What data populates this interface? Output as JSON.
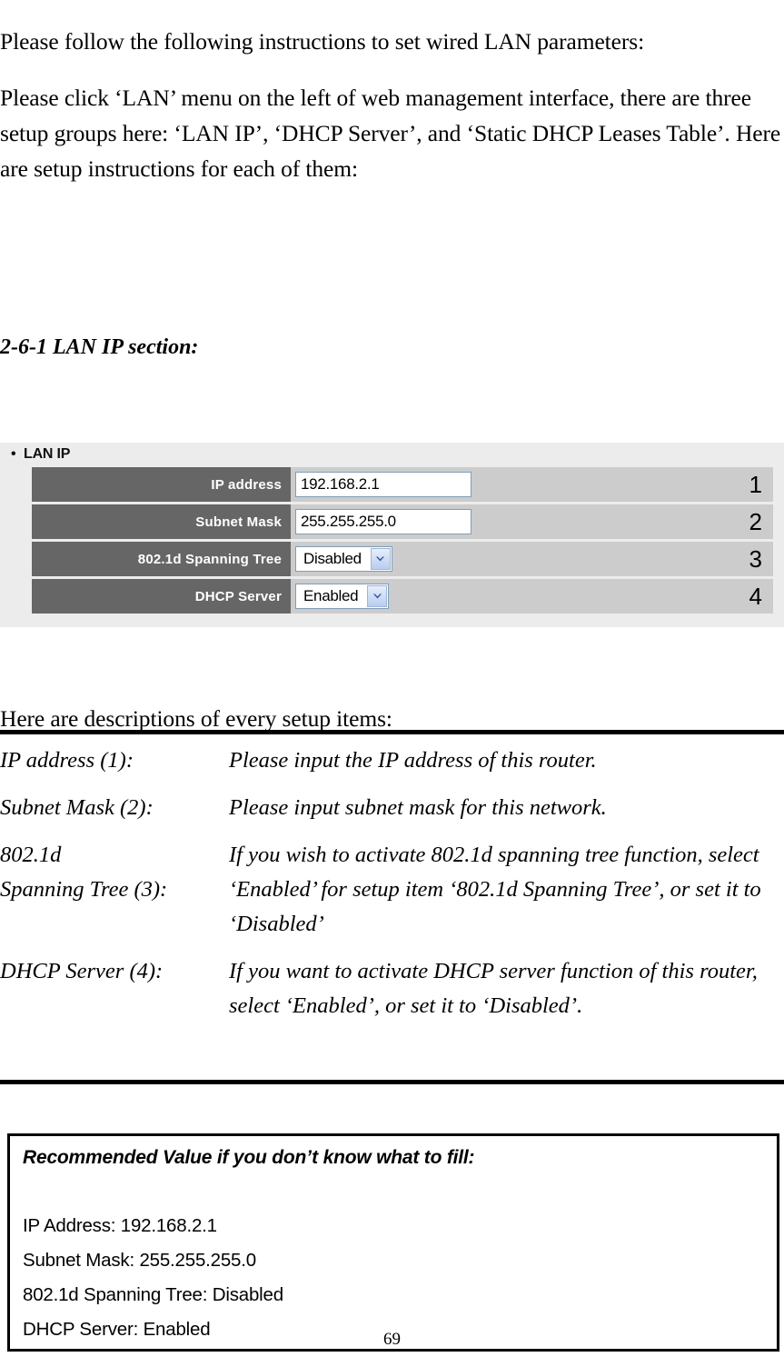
{
  "document": {
    "intro_paragraph_1": "Please follow the following instructions to set wired LAN parameters:",
    "intro_paragraph_2": "Please click ‘LAN’ menu on the left of web management interface, there are three setup groups here: ‘LAN IP’, ‘DHCP Server’, and ‘Static DHCP Leases Table’. Here are setup instructions for each of them:",
    "section_heading": "2-6-1 LAN IP section:",
    "descriptions_intro": "Here are descriptions of every setup items:",
    "page_number": "69"
  },
  "ui_panel": {
    "group_title": "LAN IP",
    "bullet_glyph": "•",
    "colors": {
      "panel_background": "#ececec",
      "label_cell": "#666666",
      "value_cell": "#cccccc",
      "input_border": "#7f9db9",
      "input_background": "#ffffff",
      "dropdown_arrow": "#2b5797"
    },
    "rows": [
      {
        "label": "IP address",
        "control": "textbox",
        "value": "192.168.2.1",
        "number": "1"
      },
      {
        "label": "Subnet Mask",
        "control": "textbox",
        "value": "255.255.255.0",
        "number": "2"
      },
      {
        "label": "802.1d Spanning Tree",
        "control": "dropdown",
        "value": "Disabled",
        "number": "3"
      },
      {
        "label": "DHCP Server",
        "control": "dropdown",
        "value": "Enabled",
        "number": "4"
      }
    ]
  },
  "descriptions": [
    {
      "term": "IP address (1):",
      "definition": "Please input the IP address of this router."
    },
    {
      "term": "Subnet Mask (2):",
      "definition": "Please input subnet mask for this network."
    },
    {
      "term": "802.1d\nSpanning Tree (3):",
      "term_line_1": "802.1d",
      "term_line_2": "Spanning Tree (3):",
      "definition": "If you wish to activate 802.1d spanning tree function, select ‘Enabled’ for setup item ‘802.1d Spanning Tree’, or set it to ‘Disabled’"
    },
    {
      "term": "DHCP Server (4):",
      "definition": "If you want to activate DHCP server function of this router, select ‘Enabled’, or set it to ‘Disabled’."
    }
  ],
  "recommended_box": {
    "title": "Recommended Value if you don’t know what to fill:",
    "lines": [
      "IP Address: 192.168.2.1",
      "Subnet Mask: 255.255.255.0",
      "802.1d Spanning Tree: Disabled",
      "DHCP Server: Enabled"
    ]
  }
}
